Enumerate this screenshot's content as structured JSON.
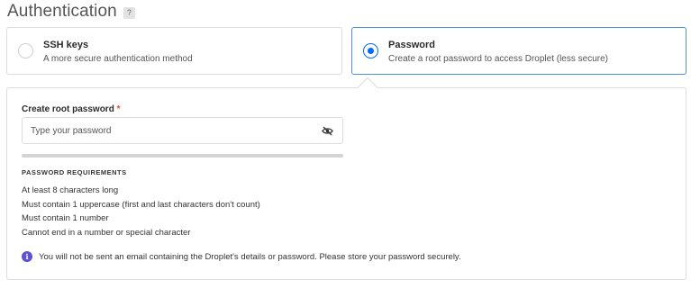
{
  "section": {
    "title": "Authentication",
    "help_label": "?"
  },
  "options": {
    "ssh": {
      "title": "SSH keys",
      "description": "A more secure authentication method",
      "selected": false
    },
    "password": {
      "title": "Password",
      "description": "Create a root password to access Droplet (less secure)",
      "selected": true
    }
  },
  "password_field": {
    "label": "Create root password",
    "required_marker": "*",
    "value": "",
    "placeholder": "Type your password",
    "visibility_icon": "eye-slash-icon"
  },
  "strength_meter": {
    "level": 0
  },
  "requirements": {
    "heading": "PASSWORD REQUIREMENTS",
    "items": [
      "At least 8 characters long",
      "Must contain 1 uppercase (first and last characters don't count)",
      "Must contain 1 number",
      "Cannot end in a number or special character"
    ]
  },
  "notice": {
    "icon": "info-icon",
    "text": "You will not be sent an email containing the Droplet's details or password. Please store your password securely."
  },
  "colors": {
    "accent": "#0069ff",
    "selected_border": "#4a90e2",
    "info": "#5b50d6",
    "required": "#e34a2f"
  }
}
